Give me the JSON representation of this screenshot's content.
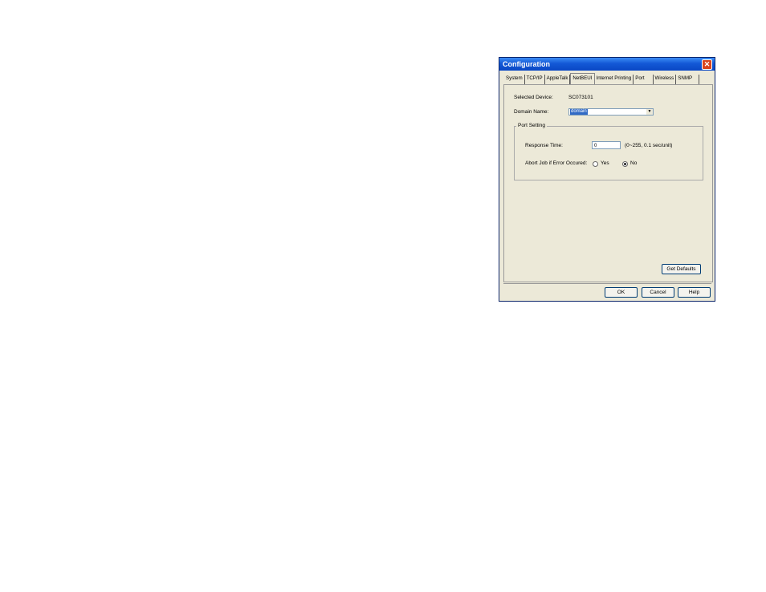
{
  "window": {
    "title": "Configuration",
    "close_glyph": "✕"
  },
  "tabs": [
    {
      "label": "System"
    },
    {
      "label": "TCP/IP"
    },
    {
      "label": "AppleTalk"
    },
    {
      "label": "NetBEUI"
    },
    {
      "label": "Internet Printing"
    },
    {
      "label": "Port"
    },
    {
      "label": "Wireless"
    },
    {
      "label": "SNMP"
    }
  ],
  "active_tab": "NetBEUI",
  "fields": {
    "selected_device_label": "Selected Device:",
    "selected_device_value": "SC073101",
    "domain_name_label": "Domain Name:",
    "domain_name_value": "domain",
    "dropdown_glyph": "▼"
  },
  "port_setting": {
    "title": "Port Setting",
    "response_time_label": "Response Time:",
    "response_time_value": "0",
    "response_time_hint": "(0~255, 0.1 sec/unit)",
    "abort_job_label": "Abort Job if Error Occured:",
    "yes_label": "Yes",
    "no_label": "No",
    "selected": "No"
  },
  "buttons": {
    "get_defaults": "Get Defaults",
    "ok": "OK",
    "cancel": "Cancel",
    "help": "Help"
  }
}
